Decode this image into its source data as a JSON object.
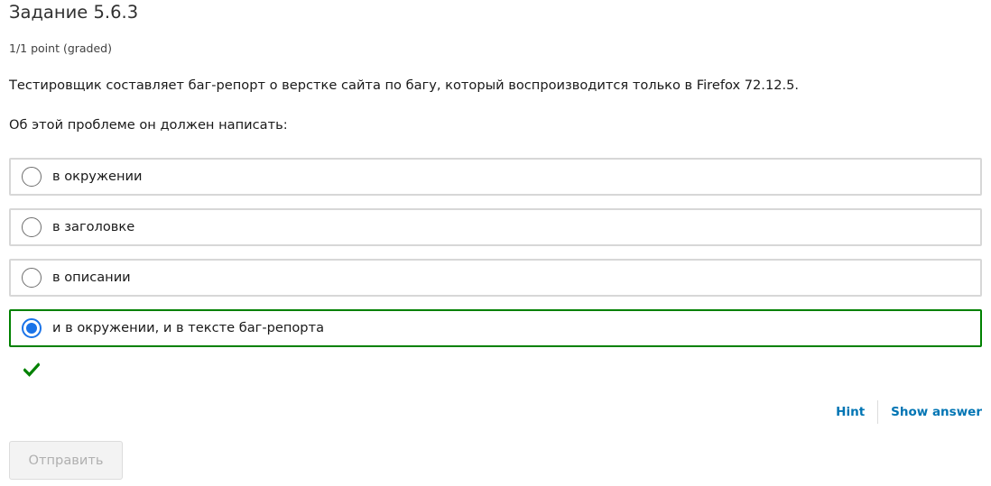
{
  "problem": {
    "title": "Задание 5.6.3",
    "points": "1/1 point (graded)",
    "question": "Тестировщик составляет баг-репорт о верстке сайта по багу, который воспроизводится только в Firefox 72.12.5.",
    "prompt": "Об этой проблеме он должен написать:"
  },
  "options": [
    {
      "label": "в окружении",
      "selected": false
    },
    {
      "label": "в заголовке",
      "selected": false
    },
    {
      "label": "в описании",
      "selected": false
    },
    {
      "label": "и в окружении, и в тексте баг-репорта",
      "selected": true
    }
  ],
  "status": {
    "icon": "checkmark-icon",
    "color": "#008100"
  },
  "actions": {
    "hint": "Hint",
    "show_answer": "Show answer"
  },
  "submit": {
    "label": "Отправить"
  },
  "colors": {
    "link": "#0075b4",
    "correct": "#008100",
    "radio_selected": "#1a73e8",
    "option_border": "#d7d7d7"
  }
}
